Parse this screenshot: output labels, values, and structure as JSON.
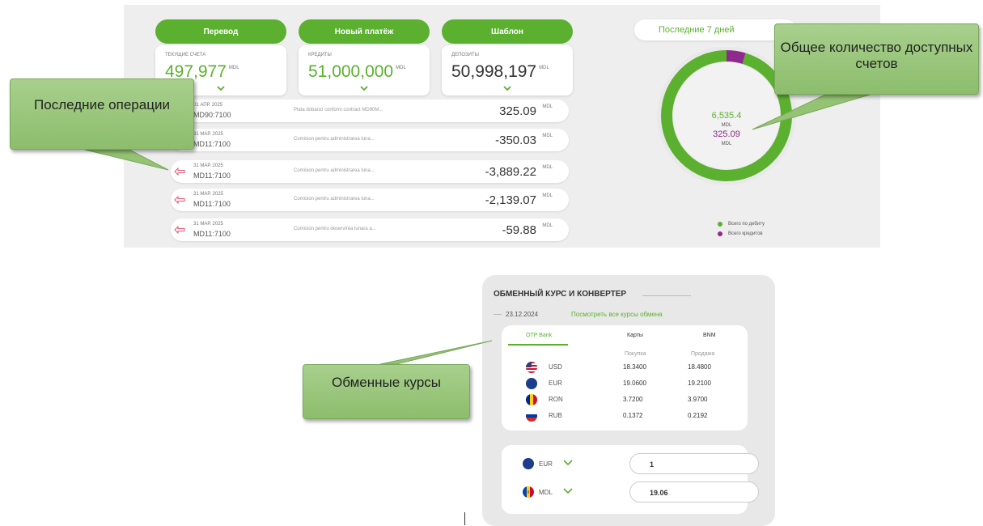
{
  "actions": {
    "transfer": "Перевод",
    "new_payment": "Новый платёж",
    "template": "Шаблон"
  },
  "summary": [
    {
      "label": "ТЕКУЩИЕ СЧЕТА",
      "value": "497,977",
      "currency": "MDL"
    },
    {
      "label": "КРЕДИТЫ",
      "value": "51,000,000",
      "currency": "MDL"
    },
    {
      "label": "ДЕПОЗИТЫ",
      "value": "50,998,197",
      "currency": "MDL"
    }
  ],
  "operations": [
    {
      "date": "01 АПР. 2025",
      "account": "MD90:7100",
      "description": "Plata dobanzi conform contract MD90M...",
      "amount": "325.09",
      "currency": "MDL",
      "direction": "in"
    },
    {
      "date": "31 МАР. 2025",
      "account": "MD11:7100",
      "description": "Comision pentru administrarea luna...",
      "amount": "-350.03",
      "currency": "MDL",
      "direction": "out"
    },
    {
      "date": "31 МАР. 2025",
      "account": "MD11:7100",
      "description": "Comision pentru administrarea luna...",
      "amount": "-3,889.22",
      "currency": "MDL",
      "direction": "out"
    },
    {
      "date": "31 МАР. 2025",
      "account": "MD11:7100",
      "description": "Comision pentru administrarea luna...",
      "amount": "-2,139.07",
      "currency": "MDL",
      "direction": "out"
    },
    {
      "date": "31 МАР. 2025",
      "account": "MD11:7100",
      "description": "Comision pentru deservirea lunara a...",
      "amount": "-59.88",
      "currency": "MDL",
      "direction": "out"
    }
  ],
  "period": {
    "label": "Последние 7 дней"
  },
  "donut": {
    "debit_value": "6,535.4",
    "debit_currency": "MDL",
    "credit_value": "325.09",
    "credit_currency": "MDL",
    "credit_share": 0.047,
    "colors": {
      "debit": "#5cb030",
      "credit": "#8e2a8b",
      "track": "#e6e6e6"
    }
  },
  "legend": {
    "debit": "Всего по дебиту",
    "credit": "Всего кредитов"
  },
  "fx": {
    "title": "ОБМЕННЫЙ КУРС И КОНВЕРТЕР",
    "date": "23.12.2024",
    "link": "Посмотреть все курсы обмена",
    "tabs": [
      "OTP Bank",
      "Карты",
      "BNM"
    ],
    "active_tab": 0,
    "col_buy": "Покупка",
    "col_sell": "Продажа",
    "rates": [
      {
        "code": "USD",
        "buy": "18.3400",
        "sell": "18.4800",
        "flag": "us-flag-icon"
      },
      {
        "code": "EUR",
        "buy": "19.0600",
        "sell": "19.2100",
        "flag": "eu-flag-icon"
      },
      {
        "code": "RON",
        "buy": "3.7200",
        "sell": "3.9700",
        "flag": "ro-flag-icon"
      },
      {
        "code": "RUB",
        "buy": "0.1372",
        "sell": "0.2192",
        "flag": "ru-flag-icon"
      }
    ],
    "converter": [
      {
        "code": "EUR",
        "value": "1"
      },
      {
        "code": "MDL",
        "value": "19.06"
      }
    ]
  },
  "callouts": {
    "operations": "Последние операции",
    "accounts": "Общее количество доступных счетов",
    "rates": "Обменные курсы"
  },
  "colors": {
    "accent": "#5cb030",
    "callout": "#9fca82",
    "negative_arrow": "#e05a77"
  }
}
